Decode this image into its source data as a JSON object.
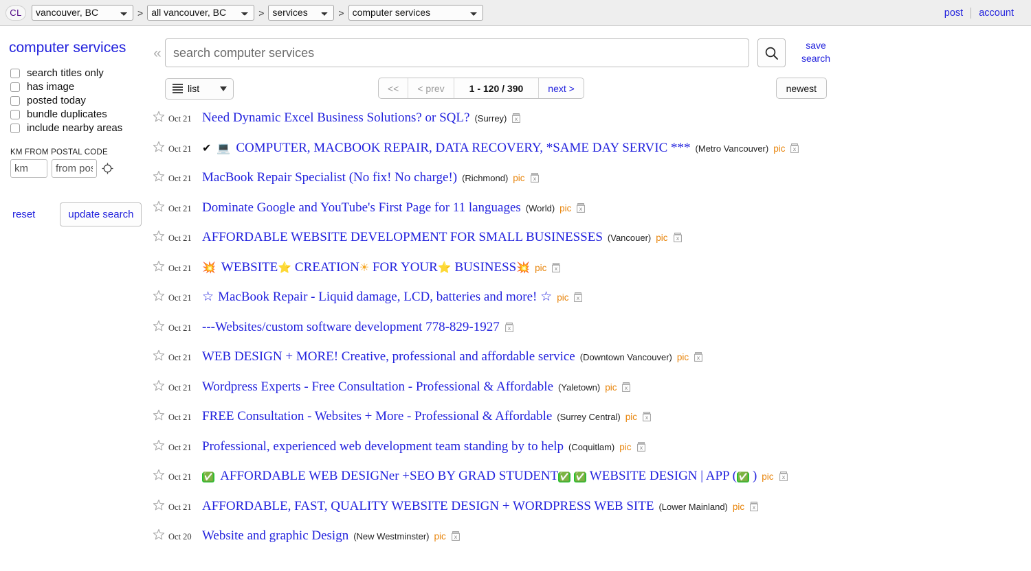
{
  "header": {
    "logo": "CL",
    "logo_icon": "craigslist-logo",
    "breadcrumbs": [
      {
        "name": "city",
        "value": "vancouver, BC",
        "options": [
          "vancouver, BC"
        ]
      },
      {
        "name": "area",
        "value": "all vancouver, BC",
        "options": [
          "all vancouver, BC"
        ]
      },
      {
        "name": "category",
        "value": "services",
        "options": [
          "services"
        ]
      },
      {
        "name": "subcategory",
        "value": "computer services",
        "options": [
          "computer services"
        ]
      }
    ],
    "separator": ">",
    "post_label": "post",
    "account_label": "account",
    "link_color": "#2222dd"
  },
  "sidebar": {
    "title": "computer services",
    "checkboxes": [
      {
        "label": "search titles only",
        "checked": false
      },
      {
        "label": "has image",
        "checked": false
      },
      {
        "label": "posted today",
        "checked": false
      },
      {
        "label": "bundle duplicates",
        "checked": false
      },
      {
        "label": "include nearby areas",
        "checked": false
      }
    ],
    "distance_label": "KM FROM POSTAL CODE",
    "km_placeholder": "km",
    "km_value": "",
    "postal_placeholder": "from postal code",
    "postal_value": "",
    "geo_icon": "crosshair-icon",
    "reset_label": "reset",
    "update_label": "update search"
  },
  "search": {
    "collapse_icon": "chevron-double-left-icon",
    "placeholder": "search computer services",
    "value": "",
    "search_icon": "search-icon",
    "save_search_line1": "save",
    "save_search_line2": "search"
  },
  "toolbar": {
    "view_mode": "list",
    "view_mode_icon": "list-icon",
    "caret_icon": "chevron-down-icon",
    "pager": {
      "first_label": "<<",
      "first_disabled": true,
      "prev_label": "< prev",
      "prev_disabled": true,
      "count_label": "1 - 120 / 390",
      "next_label": "next >",
      "next_disabled": false
    },
    "sort_label": "newest"
  },
  "results": {
    "star_icon": "star-outline-icon",
    "trash_icon": "trash-x-icon",
    "pic_label": "pic",
    "rows": [
      {
        "date": "Oct 21",
        "prefix": [],
        "title": "Need Dynamic Excel Business Solutions? or SQL?",
        "hood": "(Surrey)",
        "pic": false
      },
      {
        "date": "Oct 21",
        "prefix": [
          {
            "glyph": "✔",
            "cls": "emoji-black",
            "name": "check-mark-emoji"
          },
          {
            "glyph": "💻",
            "cls": "emoji-black",
            "name": "laptop-emoji"
          }
        ],
        "title": "COMPUTER, MACBOOK REPAIR, DATA RECOVERY, *SAME DAY SERVIC ***",
        "hood": "(Metro Vancouver)",
        "pic": true
      },
      {
        "date": "Oct 21",
        "prefix": [],
        "title": "MacBook Repair Specialist (No fix! No charge!)",
        "hood": "(Richmond)",
        "pic": true
      },
      {
        "date": "Oct 21",
        "prefix": [],
        "title": "Dominate Google and YouTube's First Page for 11 languages",
        "hood": "(World)",
        "pic": true
      },
      {
        "date": "Oct 21",
        "prefix": [],
        "title": "AFFORDABLE WEBSITE DEVELOPMENT FOR SMALL BUSINESSES",
        "hood": "(Vancouer)",
        "pic": true
      },
      {
        "date": "Oct 21",
        "prefix": [
          {
            "glyph": "💥",
            "cls": "emoji-red",
            "name": "collision-emoji"
          }
        ],
        "title_parts": [
          {
            "text": "WEBSITE",
            "cls": ""
          },
          {
            "text": "⭐",
            "cls": "emoji emoji-gold"
          },
          {
            "text": " CREATION",
            "cls": ""
          },
          {
            "text": "☀",
            "cls": "emoji emoji-sun"
          },
          {
            "text": " FOR YOUR",
            "cls": ""
          },
          {
            "text": "⭐",
            "cls": "emoji emoji-gold"
          },
          {
            "text": " BUSINESS",
            "cls": ""
          },
          {
            "text": "💥",
            "cls": "emoji emoji-red"
          }
        ],
        "title": "WEBSITE⭐ CREATION☀ FOR YOUR⭐ BUSINESS💥",
        "hood": "",
        "pic": true
      },
      {
        "date": "Oct 21",
        "prefix": [],
        "title_parts": [
          {
            "text": "☆ ",
            "cls": "emoji-star-blue"
          },
          {
            "text": "MacBook Repair - Liquid damage, LCD, batteries and more! ",
            "cls": ""
          },
          {
            "text": "☆",
            "cls": "emoji-star-blue"
          }
        ],
        "title": "☆ MacBook Repair - Liquid damage, LCD, batteries and more! ☆",
        "hood": "",
        "pic": true
      },
      {
        "date": "Oct 21",
        "prefix": [],
        "title": "---Websites/custom software development 778-829-1927",
        "hood": "",
        "pic": false
      },
      {
        "date": "Oct 21",
        "prefix": [],
        "title": "WEB DESIGN + MORE! Creative, professional and affordable service",
        "hood": "(Downtown Vancouver)",
        "pic": true
      },
      {
        "date": "Oct 21",
        "prefix": [],
        "title": "Wordpress Experts - Free Consultation - Professional & Affordable",
        "hood": "(Yaletown)",
        "pic": true
      },
      {
        "date": "Oct 21",
        "prefix": [],
        "title": "FREE Consultation - Websites + More - Professional & Affordable",
        "hood": "(Surrey Central)",
        "pic": true
      },
      {
        "date": "Oct 21",
        "prefix": [],
        "title": "Professional, experienced web development team standing by to help",
        "hood": "(Coquitlam)",
        "pic": true
      },
      {
        "date": "Oct 21",
        "prefix": [
          {
            "glyph": "✅",
            "cls": "emoji-green",
            "name": "check-box-emoji"
          }
        ],
        "title_parts": [
          {
            "text": "AFFORDABLE WEB DESIGNer +SEO BY GRAD STUDENT",
            "cls": ""
          },
          {
            "text": "✅",
            "cls": "emoji emoji-green"
          },
          {
            "text": " ",
            "cls": ""
          },
          {
            "text": "✅",
            "cls": "emoji emoji-green"
          },
          {
            "text": " WEBSITE DESIGN | APP (",
            "cls": ""
          },
          {
            "text": "✅",
            "cls": "emoji emoji-green"
          },
          {
            "text": " )",
            "cls": ""
          }
        ],
        "title": "AFFORDABLE WEB DESIGNer +SEO BY GRAD STUDENT✅ ✅ WEBSITE DESIGN | APP (✅ )",
        "hood": "",
        "pic": true
      },
      {
        "date": "Oct 21",
        "prefix": [],
        "title": "AFFORDABLE, FAST, QUALITY WEBSITE DESIGN + WORDPRESS WEB SITE",
        "hood": "(Lower Mainland)",
        "pic": true
      },
      {
        "date": "Oct 20",
        "prefix": [],
        "title": "Website and graphic Design",
        "hood": "(New Westminster)",
        "pic": true
      }
    ]
  },
  "colors": {
    "link": "#2222dd",
    "pic": "#e8840a",
    "header_bg": "#eeeeee",
    "page_bg": "#ffffff"
  }
}
